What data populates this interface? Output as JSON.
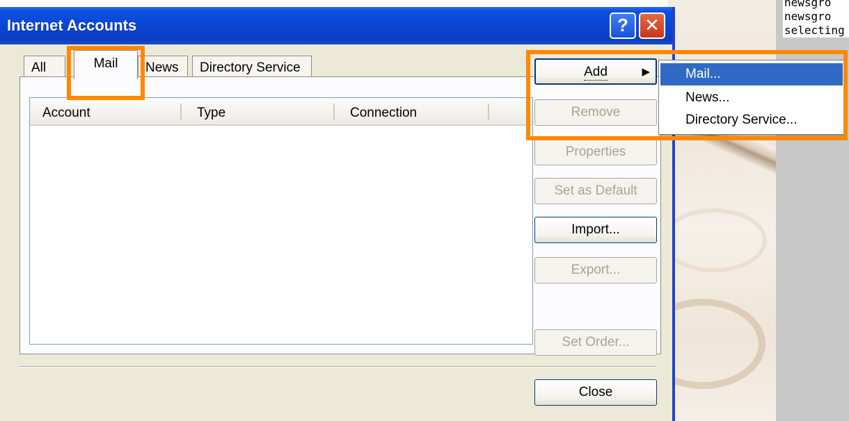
{
  "dialog": {
    "title": "Internet Accounts",
    "help_button": "?",
    "close_glyph": "✕"
  },
  "tabs": [
    {
      "label": "All"
    },
    {
      "label": "Mail",
      "selected": true
    },
    {
      "label": "News"
    },
    {
      "label": "Directory Service"
    }
  ],
  "list": {
    "columns": [
      "Account",
      "Type",
      "Connection"
    ],
    "rows": []
  },
  "buttons": {
    "add": "Add",
    "remove": "Remove",
    "properties": "Properties",
    "set_default": "Set as Default",
    "import": "Import...",
    "export": "Export...",
    "set_order": "Set Order...",
    "close": "Close"
  },
  "add_menu": {
    "items": [
      "Mail...",
      "News...",
      "Directory Service..."
    ],
    "highlighted": "Mail..."
  },
  "background_text": [
    "newsgro",
    "newsgro",
    "selecting"
  ],
  "colors": {
    "title_bar": "#0a46d4",
    "highlight": "#ff8800",
    "menu_selection": "#316ac5",
    "dialog_bg": "#ece9d8"
  }
}
